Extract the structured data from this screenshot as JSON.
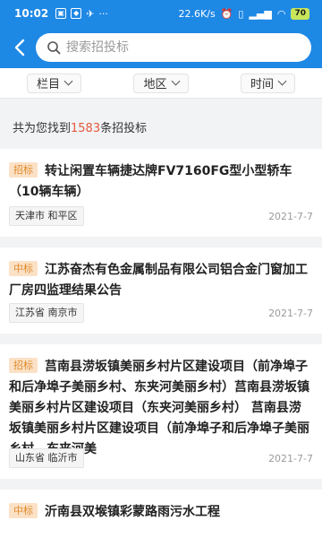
{
  "status_bar": {
    "time": "10:02",
    "speed": "22.6K/s",
    "battery": "70"
  },
  "search": {
    "placeholder": "搜索招投标"
  },
  "filters": [
    {
      "label": "栏目"
    },
    {
      "label": "地区"
    },
    {
      "label": "时间"
    }
  ],
  "summary": {
    "prefix": "共为您找到",
    "count": "1583",
    "suffix": "条招投标"
  },
  "items": [
    {
      "tag": "招标",
      "title": "转让闲置车辆捷达牌FV7160FG型小型轿车（10辆车辆）",
      "region": "天津市 和平区",
      "date": "2021-7-7"
    },
    {
      "tag": "中标",
      "title": "江苏奋杰有色金属制品有限公司铝合金门窗加工厂房四监理结果公告",
      "region": "江苏省 南京市",
      "date": "2021-7-7"
    },
    {
      "tag": "招标",
      "title": "莒南县涝坂镇美丽乡村片区建设项目（前净埠子和后净埠子美丽乡村、东夹河美丽乡村）莒南县涝坂镇美丽乡村片区建设项目（东夹河美丽乡村） 莒南县涝坂镇美丽乡村片区建设项目（前净埠子和后净埠子美丽乡村、东夹河美",
      "region": "山东省 临沂市",
      "date": "2021-7-7"
    },
    {
      "tag": "中标",
      "title": "沂南县双堠镇彩蒙路雨污水工程",
      "region": "",
      "date": ""
    }
  ]
}
